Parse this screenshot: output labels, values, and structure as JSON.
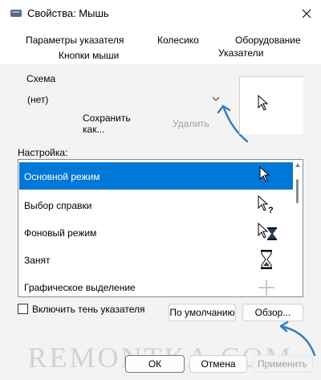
{
  "window": {
    "title": "Свойства: Мышь",
    "close_icon": "close-icon",
    "app_icon": "mouse-icon"
  },
  "tabs": [
    {
      "label": "Параметры указателя"
    },
    {
      "label": "Колесико"
    },
    {
      "label": "Оборудование"
    },
    {
      "label": "Кнопки мыши"
    },
    {
      "label": "Указатели",
      "active": true
    }
  ],
  "scheme": {
    "label": "Схема",
    "value": "(нет)",
    "save_label": "Сохранить как...",
    "delete_label": "Удалить"
  },
  "customize": {
    "label": "Настройка:",
    "items": [
      {
        "label": "Основной режим",
        "icon": "arrow-cursor-icon",
        "selected": true
      },
      {
        "label": "Выбор справки",
        "icon": "help-cursor-icon"
      },
      {
        "label": "Фоновый режим",
        "icon": "working-background-cursor-icon"
      },
      {
        "label": "Занят",
        "icon": "busy-hourglass-icon"
      },
      {
        "label": "Графическое выделение",
        "icon": "precision-crosshair-icon"
      }
    ]
  },
  "shadow": {
    "label": "Включить тень указателя",
    "checked": false
  },
  "buttons": {
    "default_label": "По умолчанию",
    "browse_label": "Обзор...",
    "ok_label": "ОК",
    "cancel_label": "Отмена",
    "apply_label": "Применить"
  },
  "watermark": "REMONTKA.COM",
  "colors": {
    "selection": "#0078d7",
    "annotation_arrow": "#2f7fc1"
  }
}
